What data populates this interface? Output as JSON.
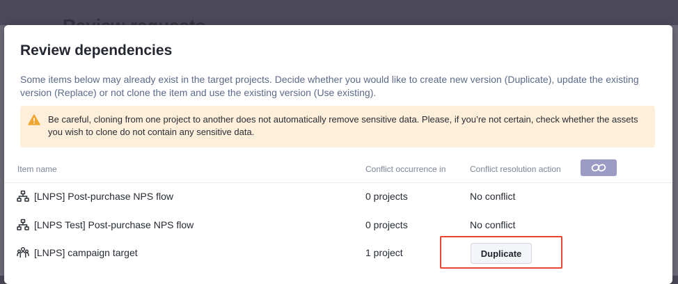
{
  "background": {
    "page_title": "Review requests"
  },
  "modal": {
    "title": "Review dependencies",
    "description": "Some items below may already exist in the target projects. Decide whether you would like to create new version (Duplicate), update the existing version (Replace) or not clone the item and use the existing version (Use existing).",
    "warning": {
      "icon": "warning-triangle-icon",
      "text": "Be careful, cloning from one project to another does not automatically remove sensitive data. Please, if you’re not certain, check whether the assets you wish to clone do not contain any sensitive data."
    },
    "table": {
      "headers": {
        "item_name": "Item name",
        "conflict_occurrence": "Conflict occurrence in",
        "conflict_resolution": "Conflict resolution action"
      },
      "link_toggle_icon": "link-icon",
      "rows": [
        {
          "icon": "flow-icon",
          "name": "[LNPS] Post-purchase NPS flow",
          "occurrence": "0 projects",
          "resolution": "No conflict"
        },
        {
          "icon": "flow-icon",
          "name": "[LNPS Test] Post-purchase NPS flow",
          "occurrence": "0 projects",
          "resolution": "No conflict"
        },
        {
          "icon": "audience-icon",
          "name": "[LNPS] campaign target",
          "occurrence": "1 project",
          "resolution_button": "Duplicate"
        }
      ]
    }
  },
  "colors": {
    "warning_bg": "#fdefd9",
    "warning_icon": "#f0a531",
    "highlight": "#e8442e",
    "toggle_bg": "#9c9bc6"
  }
}
